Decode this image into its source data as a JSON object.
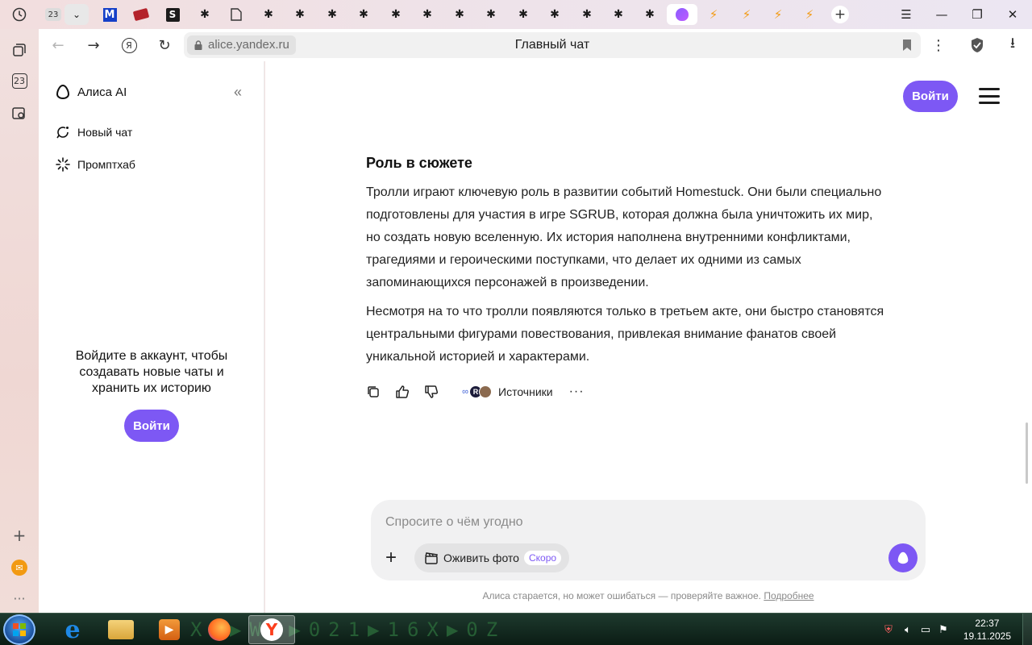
{
  "tabs": {
    "first_badge": "23",
    "active_index": 19
  },
  "toolbar": {
    "url": "alice.yandex.ru",
    "page_title": "Главный чат"
  },
  "sidepanel": {
    "calendar_badge": "23"
  },
  "sidebar": {
    "brand": "Алиса AI",
    "items": [
      {
        "label": "Новый чат",
        "icon": "new-chat-icon"
      },
      {
        "label": "Промптхаб",
        "icon": "sparkle-icon"
      }
    ],
    "login_prompt": "Войдите в аккаунт, чтобы создавать новые чаты и хранить их историю",
    "login_button": "Войти"
  },
  "header": {
    "login_button": "Войти"
  },
  "message": {
    "section_title": "Роль в сюжете",
    "paragraphs": [
      "Тролли играют ключевую роль в развитии событий Homestuck. Они были специально подготовлены для участия в игре SGRUB, которая должна была уничтожить их мир, но создать новую вселенную. Их история наполнена внутренними конфликтами, трагедиями и героическими поступками, что делает их одними из самых запоминающихся персонажей в произведении.",
      "Несмотря на то что тролли появляются только в третьем акте, они быстро становятся центральными фигурами повествования, привлекая внимание фанатов своей уникальной историей и характерами."
    ],
    "sources_label": "Источники",
    "more": "···"
  },
  "composer": {
    "placeholder": "Спросите о чём угодно",
    "revive_label": "Оживить фото",
    "soon_badge": "Скоро"
  },
  "disclaimer": {
    "text": "Алиса старается, но может ошибаться — проверяйте важное.",
    "link": "Подробнее"
  },
  "taskbar": {
    "time": "22:37",
    "date": "19.11.2025",
    "matrix_text": "XX▶W0▶021▶16X▶0Z"
  },
  "colors": {
    "accent": "#7d58f4",
    "text": "#222222"
  }
}
